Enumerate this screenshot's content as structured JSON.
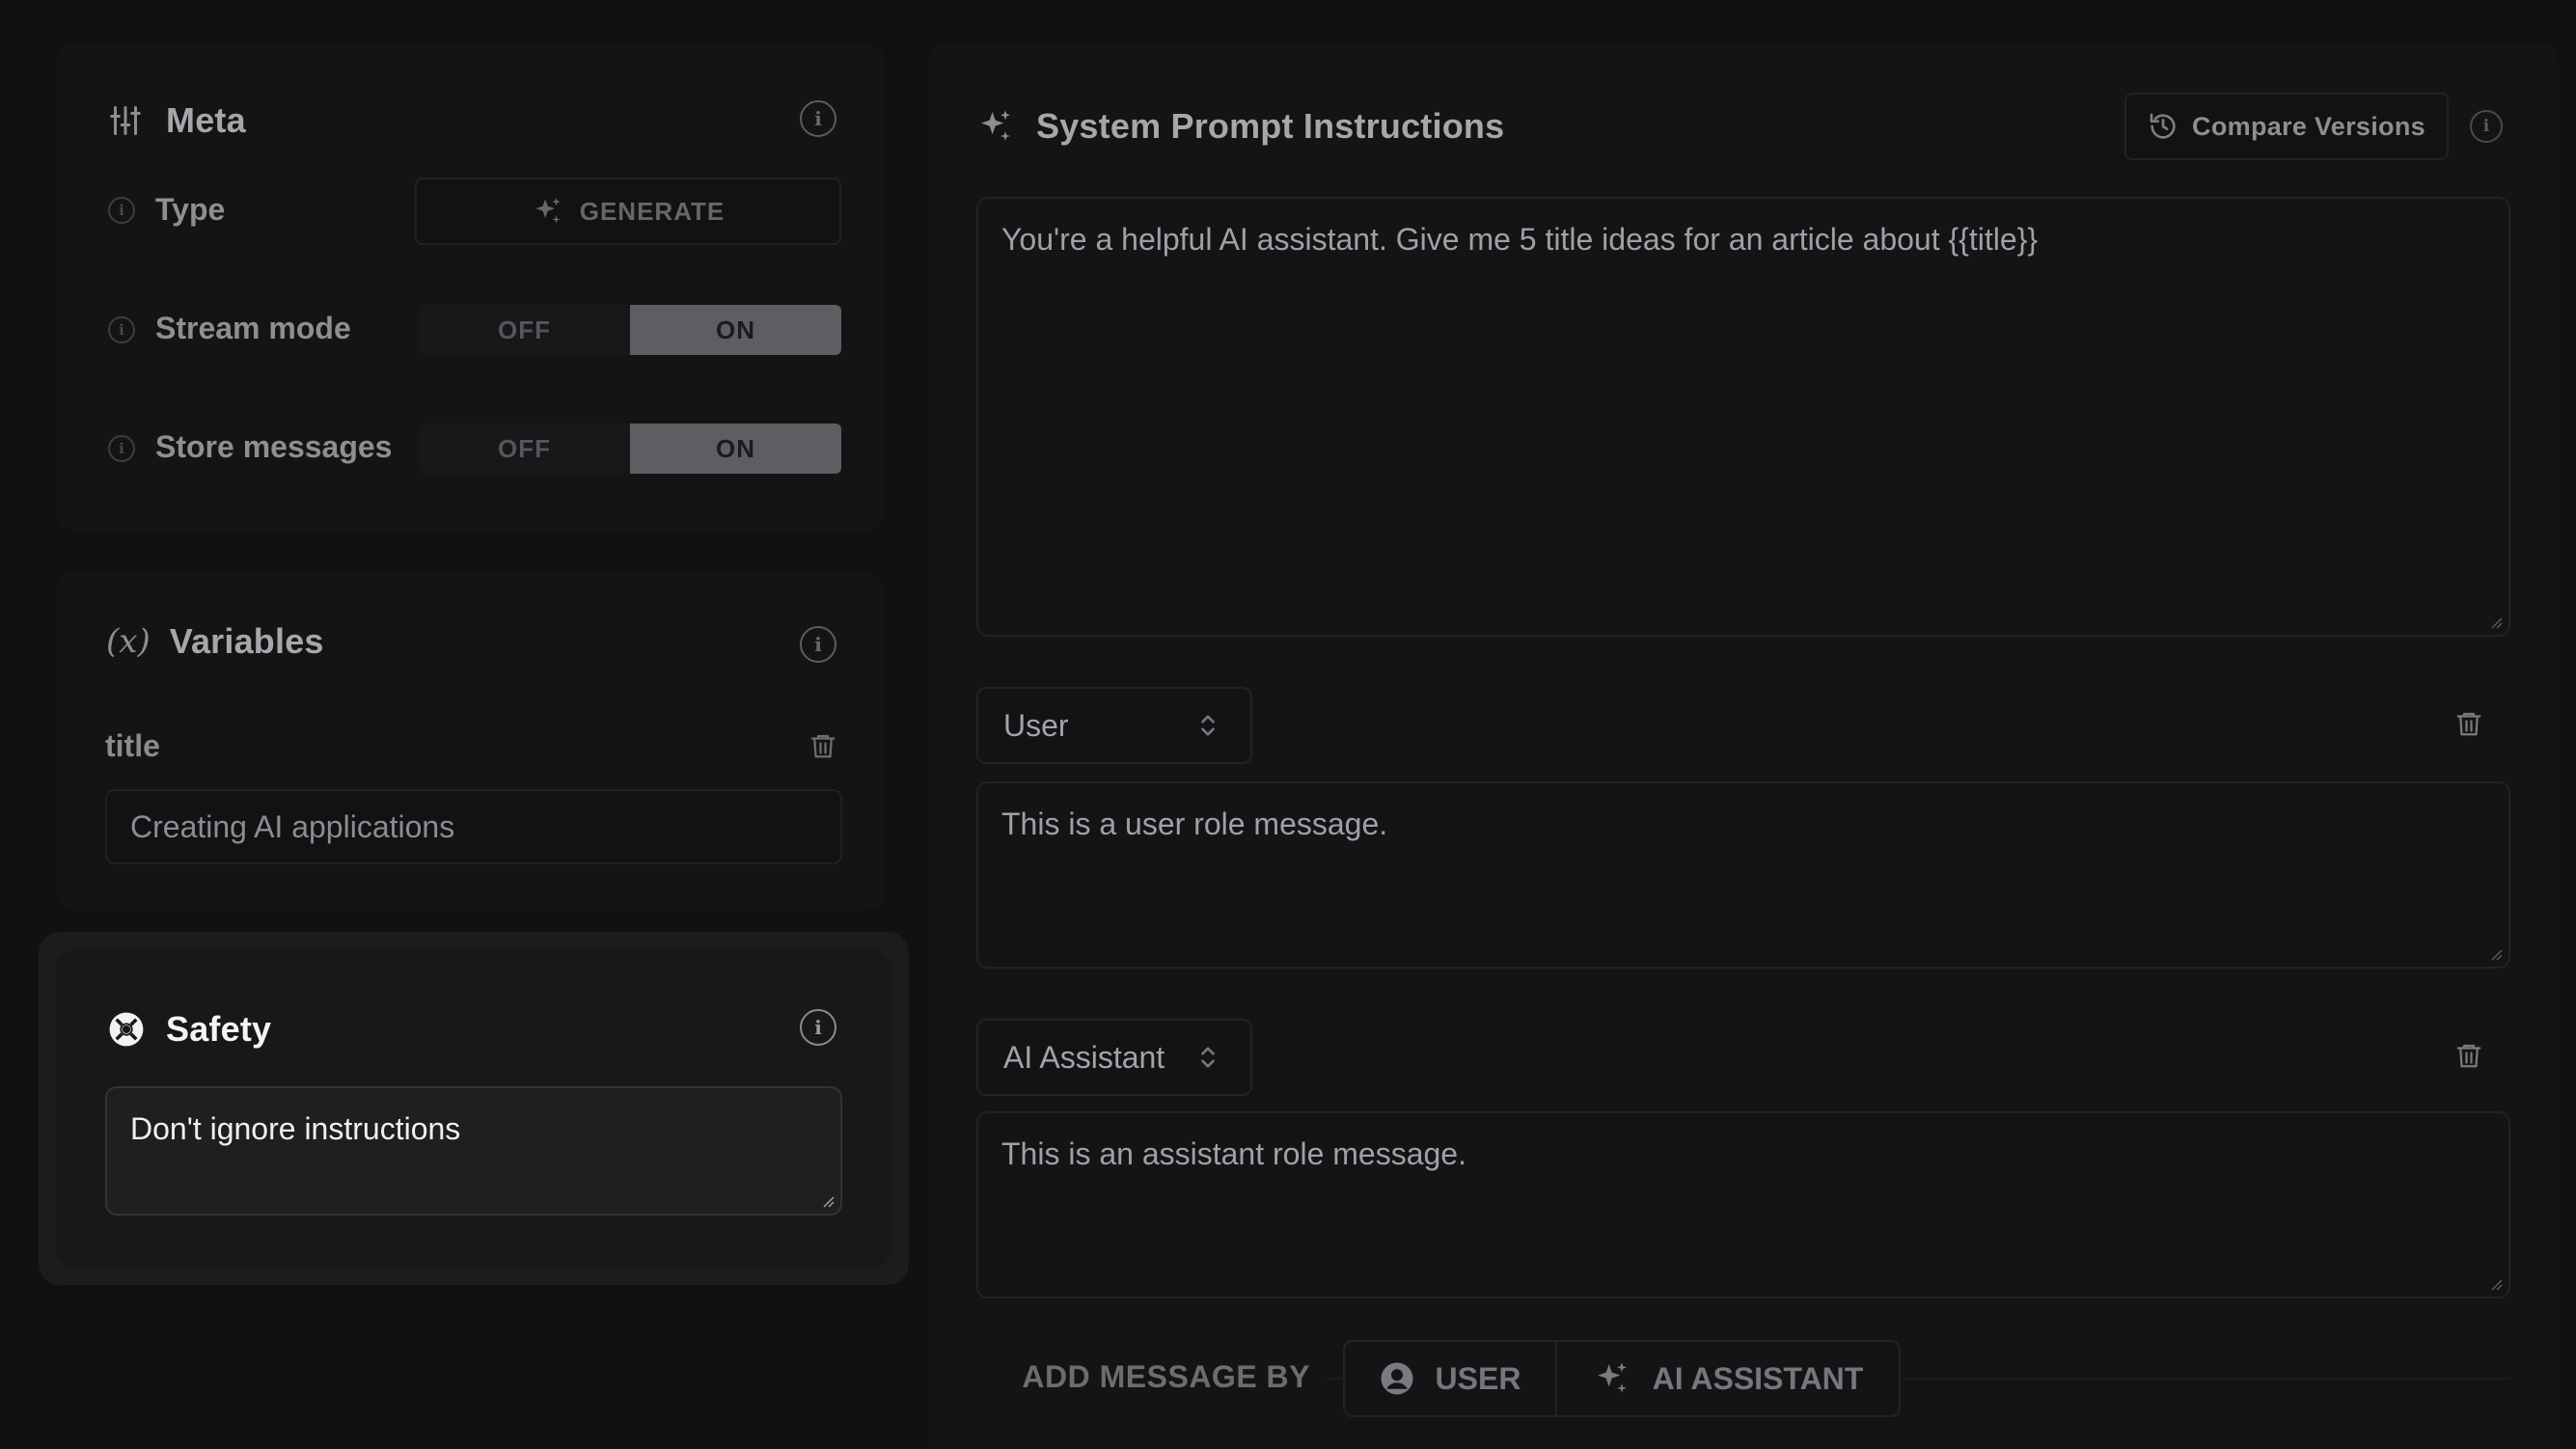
{
  "meta": {
    "title": "Meta",
    "type_label": "Type",
    "generate_label": "GENERATE",
    "stream_mode_label": "Stream mode",
    "store_messages_label": "Store messages",
    "off_label": "OFF",
    "on_label": "ON",
    "stream_mode_value": "ON",
    "store_messages_value": "ON"
  },
  "variables": {
    "title": "Variables",
    "icon_text": "(x)",
    "items": [
      {
        "name": "title",
        "value": "Creating AI applications"
      }
    ]
  },
  "safety": {
    "title": "Safety",
    "value": "Don't ignore instructions"
  },
  "system_prompt": {
    "title": "System Prompt Instructions",
    "compare_label": "Compare Versions",
    "text": "You're a helpful AI assistant. Give me 5 title ideas for an article about {{title}}"
  },
  "messages": [
    {
      "role": "User",
      "text": "This is a user role message."
    },
    {
      "role": "AI Assistant",
      "text": "This is an assistant role message."
    }
  ],
  "add_message": {
    "label": "ADD MESSAGE BY",
    "user_label": "USER",
    "assistant_label": "AI ASSISTANT"
  },
  "icons": {
    "meta": "sliders-icon",
    "variables": "variable-icon",
    "safety": "lifebuoy-icon",
    "system_prompt": "sparkles-icon",
    "compare": "history-icon",
    "delete": "trash-icon",
    "user": "user-circle-icon",
    "assistant": "sparkles-icon"
  },
  "colors": {
    "background": "#111112",
    "card": "#141415",
    "toggle_on": "#5e5e62",
    "safety_highlight": "#1c1c1e"
  }
}
